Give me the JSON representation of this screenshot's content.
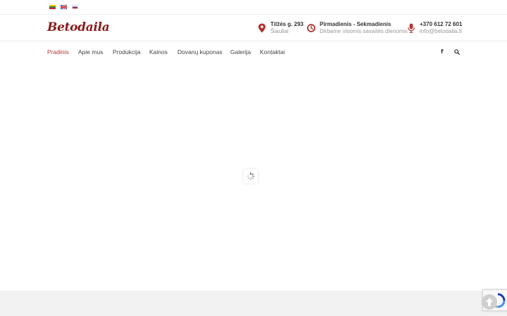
{
  "languages": [
    {
      "code": "lt",
      "icon": "flag-lithuania-icon"
    },
    {
      "code": "en",
      "icon": "flag-uk-icon"
    },
    {
      "code": "ru",
      "icon": "flag-russia-icon"
    }
  ],
  "header": {
    "logo": "Betodaila",
    "address": {
      "icon": "map-pin-icon",
      "line1": "Tilžės g. 293",
      "line2": "Šiauliai"
    },
    "hours": {
      "icon": "clock-icon",
      "line1": "Pirmadienis - Sekmadienis",
      "line2": "Dirbame visomis savaitės dienomis"
    },
    "contact": {
      "icon": "microphone-icon",
      "line1": "+370 612 72 601",
      "line2": "info@betodaila.lt"
    }
  },
  "nav": {
    "items": [
      "Pradinis",
      "Apie mus",
      "Produkcija",
      "Kainos",
      "Dovanų kuponas",
      "Galerija",
      "Kontaktai"
    ],
    "active_index": 0,
    "facebook_icon": "facebook-icon",
    "facebook_glyph": "f",
    "search_icon": "search-icon"
  },
  "colors": {
    "accent": "#b2332f",
    "logo": "#8b1c1c",
    "muted_text": "#999999",
    "footer_band": "#f2f2f2"
  },
  "loader_icon": "loading-spinner-icon",
  "back_to_top_icon": "arrow-up-icon",
  "recaptcha_icon": "recaptcha-icon"
}
